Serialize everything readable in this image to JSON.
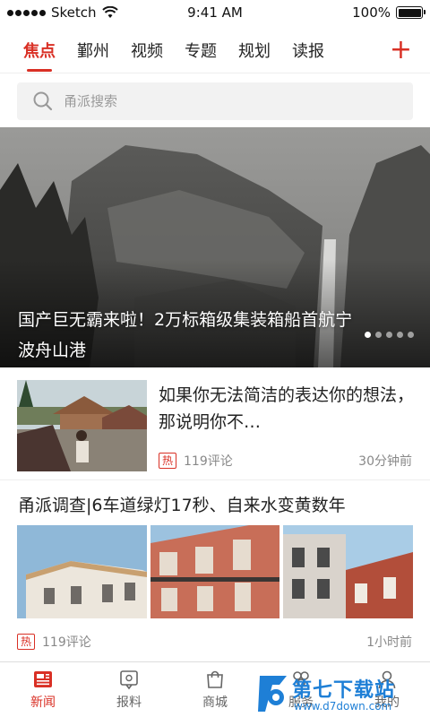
{
  "status_bar": {
    "carrier": "Sketch",
    "time": "9:41 AM",
    "battery": "100%",
    "battery_level": 1.0
  },
  "nav": {
    "tabs": [
      {
        "label": "焦点",
        "active": true
      },
      {
        "label": "鄞州",
        "active": false
      },
      {
        "label": "视频",
        "active": false
      },
      {
        "label": "专题",
        "active": false
      },
      {
        "label": "规划",
        "active": false
      },
      {
        "label": "读报",
        "active": false
      }
    ],
    "add_label": "+"
  },
  "search": {
    "placeholder": "甬派搜索"
  },
  "hero": {
    "title": "国产巨无霸来啦！2万标箱级集装箱船首航宁波舟山港",
    "slides": 5,
    "active_slide": 1
  },
  "articles": [
    {
      "title": "如果你无法简洁的表达你的想法，那说明你不…",
      "badge": "热",
      "comments": "119评论",
      "time": "30分钟前"
    },
    {
      "title": "甬派调查|6车道绿灯17秒、自来水变黄数年",
      "badge": "热",
      "comments": "119评论",
      "time": "1小时前"
    }
  ],
  "tabbar": {
    "items": [
      {
        "label": "新闻",
        "icon": "news-icon",
        "active": true
      },
      {
        "label": "报料",
        "icon": "report-icon",
        "active": false
      },
      {
        "label": "商城",
        "icon": "shop-icon",
        "active": false
      },
      {
        "label": "服务",
        "icon": "service-icon",
        "active": false
      },
      {
        "label": "我的",
        "icon": "profile-icon",
        "active": false
      }
    ]
  },
  "watermark": {
    "name": "第七下载站",
    "url": "www.d7down.com"
  },
  "colors": {
    "accent": "#d93025",
    "text": "#222222",
    "muted": "#888888"
  }
}
